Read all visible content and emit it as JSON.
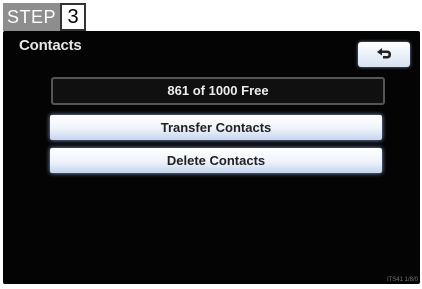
{
  "step": {
    "label": "STEP",
    "number": "3"
  },
  "screen": {
    "title": "Contacts",
    "back_icon": "back-arrow-icon",
    "free_status": "861 of 1000  Free",
    "buttons": [
      {
        "label": "Transfer Contacts"
      },
      {
        "label": "Delete Contacts"
      }
    ],
    "watermark": "ITS41 1/8/0"
  },
  "colors": {
    "screen_bg": "#040404",
    "button_glow": "#8aa3d6",
    "step_bg": "#8e8e8e"
  }
}
